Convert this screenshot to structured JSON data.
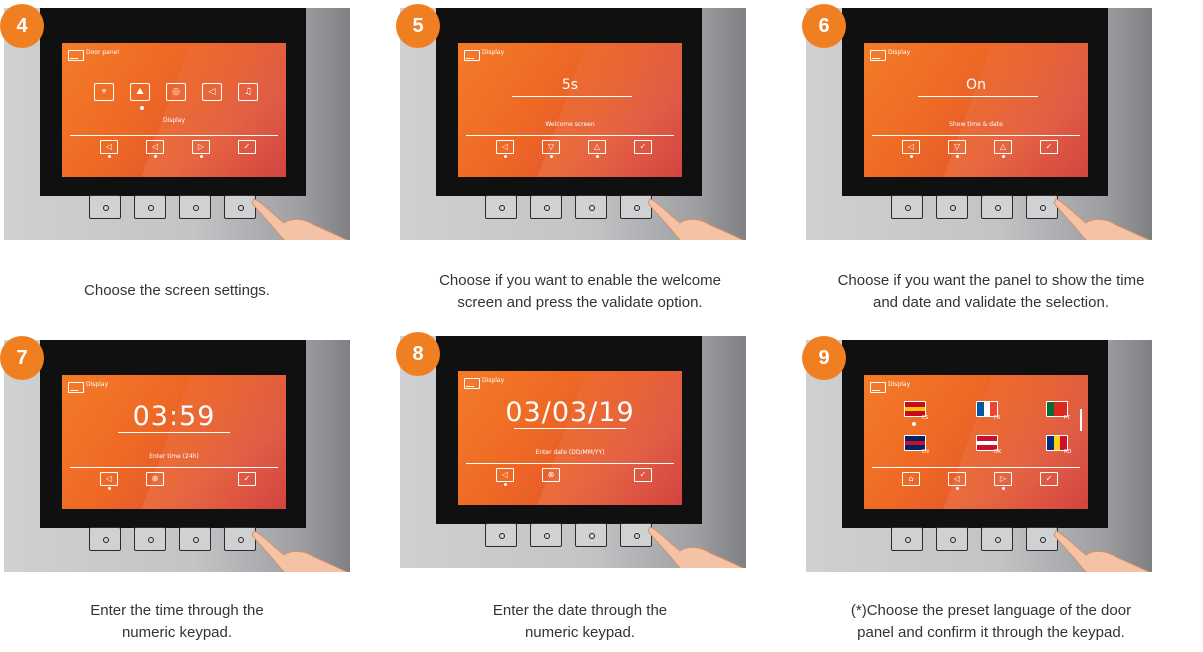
{
  "steps": [
    {
      "number": "4",
      "screen_title": "Door panel",
      "menu_icons": [
        "location-pin-icon",
        "display-image-icon",
        "camera-icon",
        "speaker-volume-icon",
        "bell-icon"
      ],
      "selected_label": "Display",
      "softkeys": [
        "back-icon",
        "left-arrow-icon",
        "right-arrow-icon",
        "confirm-check-icon"
      ],
      "description": "Choose the screen settings."
    },
    {
      "number": "5",
      "screen_title": "Display",
      "value": "5s",
      "caption": "Welcome screen",
      "softkeys": [
        "back-icon",
        "down-arrow-icon",
        "up-arrow-icon",
        "confirm-check-icon"
      ],
      "description_lines": [
        "Choose if you want to enable the welcome",
        "screen and press the validate option."
      ]
    },
    {
      "number": "6",
      "screen_title": "Display",
      "value": "On",
      "caption": "Show time & date",
      "softkeys": [
        "back-icon",
        "down-arrow-icon",
        "up-arrow-icon",
        "confirm-check-icon"
      ],
      "description_lines": [
        "Choose if you want the panel to show the time",
        "and date and validate the selection."
      ]
    },
    {
      "number": "7",
      "screen_title": "Display",
      "value": "03:59",
      "caption": "Enter time (24h)",
      "softkeys": [
        "back-icon",
        "delete-icon",
        "confirm-check-icon"
      ],
      "description_lines": [
        "Enter the time through the",
        "numeric keypad."
      ]
    },
    {
      "number": "8",
      "screen_title": "Display",
      "value": "03/03/19",
      "caption": "Enter date (DD/MM/YY)",
      "softkeys": [
        "back-icon",
        "delete-icon",
        "confirm-check-icon"
      ],
      "description_lines": [
        "Enter the date through the",
        "numeric keypad."
      ]
    },
    {
      "number": "9",
      "screen_title": "Display",
      "languages": [
        {
          "code": "ES",
          "colors": [
            "#c60b1e",
            "#ffc400",
            "#c60b1e"
          ],
          "dir": "h"
        },
        {
          "code": "FR",
          "colors": [
            "#0055a4",
            "#ffffff",
            "#ef4135"
          ],
          "dir": "v"
        },
        {
          "code": "PT",
          "colors": [
            "#046a38",
            "#da291c",
            "#da291c"
          ],
          "dir": "v"
        },
        {
          "code": "EN",
          "colors": [
            "#012169",
            "#c8102e",
            "#012169"
          ],
          "dir": "h"
        },
        {
          "code": "DK",
          "colors": [
            "#c8102e",
            "#ffffff",
            "#c8102e"
          ],
          "dir": "h"
        },
        {
          "code": "RO",
          "colors": [
            "#002b7f",
            "#fcd116",
            "#ce1126"
          ],
          "dir": "v"
        }
      ],
      "softkeys": [
        "home-icon",
        "left-arrow-icon",
        "right-arrow-icon",
        "confirm-check-icon"
      ],
      "description_lines": [
        "(*)Choose the preset language of the door",
        "panel and confirm it through the keypad."
      ]
    }
  ],
  "colors": {
    "badge": "#f07f22",
    "screen_orange": "#f47b28",
    "screen_red": "#cf3b36"
  }
}
